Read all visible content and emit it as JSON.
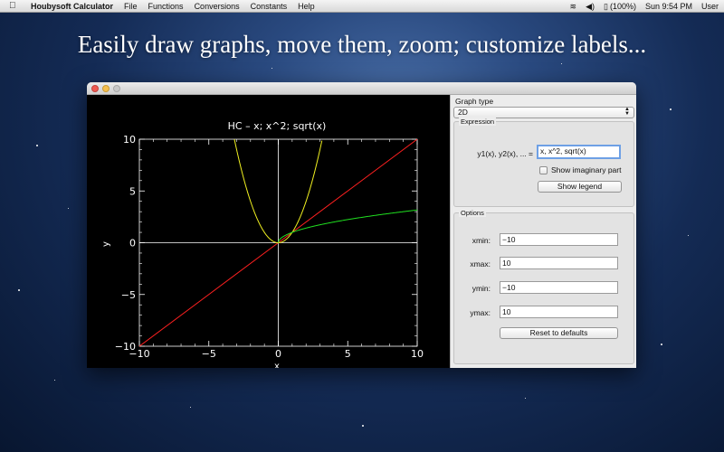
{
  "menubar": {
    "app_name": "Houbysoft Calculator",
    "items": [
      "File",
      "Functions",
      "Conversions",
      "Constants",
      "Help"
    ],
    "battery": "(100%)",
    "clock": "Sun 9:54 PM",
    "user": "User"
  },
  "headline": "Easily draw graphs, move them, zoom; customize labels...",
  "plot": {
    "title": "HC – x;  x^2;  sqrt(x)",
    "xlabel": "x",
    "ylabel": "y",
    "xticks": [
      "−10",
      "−5",
      "0",
      "5",
      "10"
    ],
    "yticks": [
      "10",
      "5",
      "0",
      "−5",
      "−10"
    ],
    "colors": {
      "series1": "#ff2020",
      "series2": "#f0f020",
      "series3": "#20e020",
      "axes": "#ffffff",
      "background": "#000000"
    }
  },
  "chart_data": {
    "type": "line",
    "title": "HC – x;  x^2;  sqrt(x)",
    "xlabel": "x",
    "ylabel": "y",
    "xlim": [
      -10,
      10
    ],
    "ylim": [
      -10,
      10
    ],
    "grid": false,
    "series": [
      {
        "x": [
          -10,
          -5,
          0,
          5,
          10
        ],
        "values": [
          -10,
          -5,
          0,
          5,
          10
        ]
      },
      {
        "x": [
          -3.16,
          -2,
          -1,
          0,
          1,
          2,
          3.16
        ],
        "values": [
          10,
          4,
          1,
          0,
          1,
          4,
          10
        ]
      },
      {
        "x": [
          0,
          1,
          2,
          4,
          6,
          8,
          10
        ],
        "values": [
          0,
          1,
          1.41,
          2,
          2.45,
          2.83,
          3.16
        ]
      }
    ]
  },
  "panel": {
    "graph_type_label": "Graph type",
    "graph_type_value": "2D",
    "expression_title": "Expression",
    "expression_label": "y1(x), y2(x), ... =",
    "expression_value": "x, x^2, sqrt(x)",
    "show_imaginary_label": "Show imaginary part",
    "show_legend_label": "Show legend",
    "options_title": "Options",
    "xmin_label": "xmin:",
    "xmin_value": "−10",
    "xmax_label": "xmax:",
    "xmax_value": "10",
    "ymin_label": "ymin:",
    "ymin_value": "−10",
    "ymax_label": "ymax:",
    "ymax_value": "10",
    "reset_label": "Reset to defaults"
  }
}
